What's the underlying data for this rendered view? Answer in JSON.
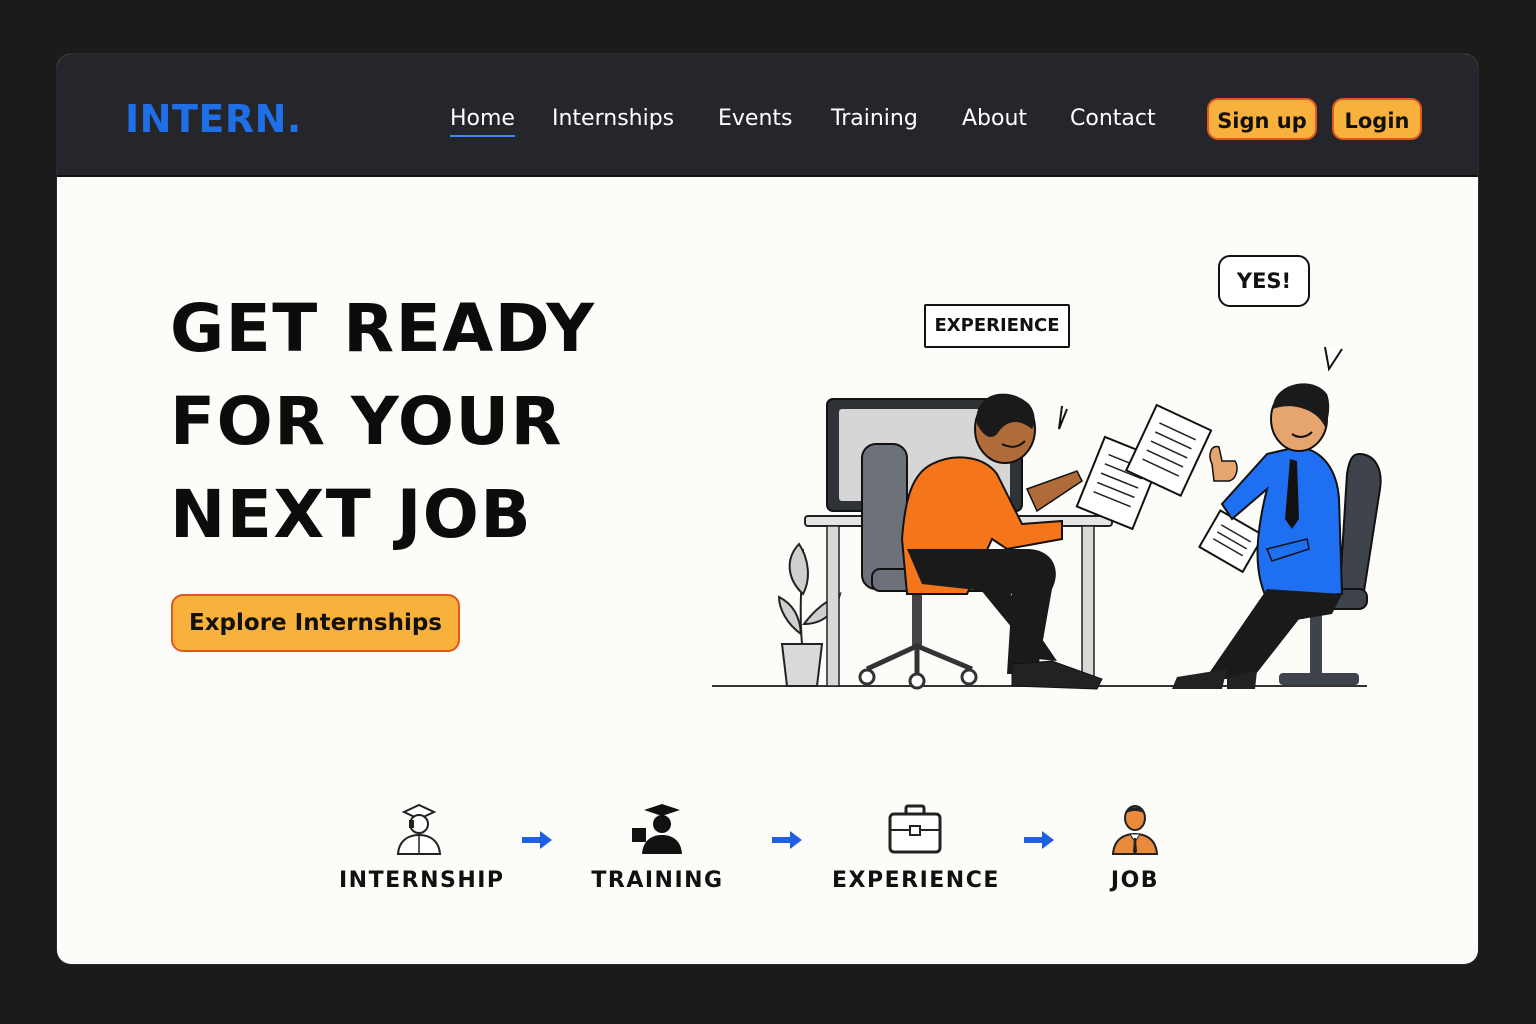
{
  "brand": {
    "logo": "INTERN.",
    "accent": "#1f6fe8",
    "button_color": "#f8b13c"
  },
  "nav": {
    "links": [
      {
        "label": "Home",
        "active": true
      },
      {
        "label": "Internships",
        "active": false
      },
      {
        "label": "Events",
        "active": false
      },
      {
        "label": "Training",
        "active": false
      },
      {
        "label": "About",
        "active": false
      },
      {
        "label": "Contact",
        "active": false
      }
    ],
    "signup_label": "Sign up",
    "login_label": "Login"
  },
  "hero": {
    "title_lines": [
      "GET READY",
      "FOR YOUR",
      "NEXT JOB"
    ],
    "cta_label": "Explore Internships"
  },
  "illustration": {
    "sign_label": "EXPERIENCE",
    "bubble_text": "YES!"
  },
  "journey": {
    "steps": [
      {
        "label": "INTERNSHIP",
        "icon": "student-graduate-icon"
      },
      {
        "label": "TRAINING",
        "icon": "graduation-cap-person-icon"
      },
      {
        "label": "EXPERIENCE",
        "icon": "briefcase-icon"
      },
      {
        "label": "JOB",
        "icon": "professional-person-icon"
      }
    ],
    "arrow_icon": "arrow-right-icon",
    "arrow_color": "#1f5fe0"
  }
}
